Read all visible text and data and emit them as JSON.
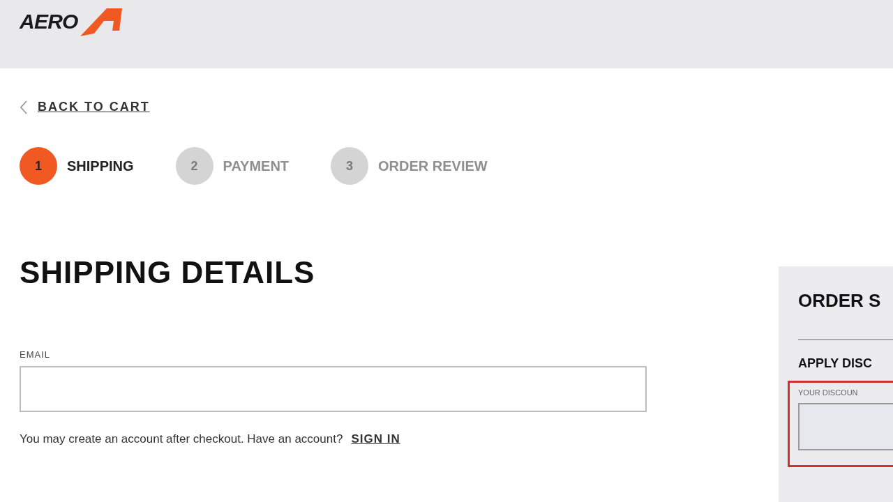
{
  "header": {
    "logo_text": "AERO"
  },
  "back_link": {
    "label": "BACK TO CART"
  },
  "steps": [
    {
      "number": "1",
      "label": "SHIPPING",
      "selected": true
    },
    {
      "number": "2",
      "label": "PAYMENT",
      "selected": false
    },
    {
      "number": "3",
      "label": "ORDER REVIEW",
      "selected": false
    }
  ],
  "form": {
    "title": "SHIPPING DETAILS",
    "email_label": "EMAIL",
    "note": "You may create an account after checkout. Have an account?",
    "sign_in": "SIGN IN"
  },
  "summary": {
    "title": "ORDER S",
    "discount_title": "APPLY DISC",
    "discount_label": "YOUR DISCOUN",
    "discount_error": true
  }
}
